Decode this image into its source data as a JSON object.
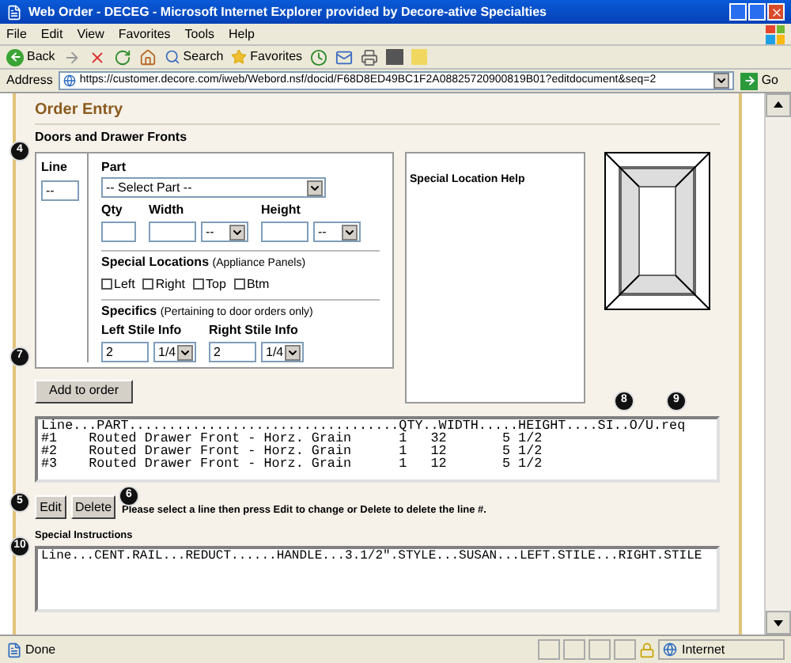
{
  "window": {
    "title": "Web Order - DECEG - Microsoft Internet Explorer provided by Decore-ative Specialties"
  },
  "menu": [
    "File",
    "Edit",
    "View",
    "Favorites",
    "Tools",
    "Help"
  ],
  "toolbar": {
    "back": "Back",
    "search": "Search",
    "favorites": "Favorites"
  },
  "address": {
    "label": "Address",
    "url": "https://customer.decore.com/iweb/Webord.nsf/docid/F68D8ED49BC1F2A08825720900819B01?editdocument&seq=2",
    "go": "Go"
  },
  "page": {
    "heading": "Order Entry",
    "section": "Doors and Drawer Fronts"
  },
  "form": {
    "line": {
      "label": "Line",
      "value": "--"
    },
    "part": {
      "label": "Part",
      "value": "-- Select Part --"
    },
    "qty": {
      "label": "Qty"
    },
    "width": {
      "label": "Width",
      "unit": "--"
    },
    "height": {
      "label": "Height",
      "unit": "--"
    },
    "special_locations": {
      "label": "Special Locations",
      "note": "(Appliance Panels)",
      "options": [
        {
          "label": "Left",
          "checked": false
        },
        {
          "label": "Right",
          "checked": false
        },
        {
          "label": "Top",
          "checked": false
        },
        {
          "label": "Btm",
          "checked": false
        }
      ]
    },
    "specifics": {
      "label": "Specifics",
      "note": "(Pertaining to door orders only)"
    },
    "left_stile": {
      "label": "Left Stile Info",
      "value": "2",
      "fraction": "1/4"
    },
    "right_stile": {
      "label": "Right Stile Info",
      "value": "2",
      "fraction": "1/4"
    }
  },
  "help_panel": {
    "title": "Special Location Help"
  },
  "add_button": "Add to order",
  "order_list": {
    "header": "Line...PART..................................QTY..WIDTH.....HEIGHT....SI..O/U.req",
    "rows": [
      {
        "text": "#1    Routed Drawer Front - Horz. Grain      1   32       5 1/2",
        "selected": false
      },
      {
        "text": "#2    Routed Drawer Front - Horz. Grain      1   12       5 1/2",
        "selected": false
      },
      {
        "text": "#3    Routed Drawer Front - Horz. Grain      1   12       5 1/2",
        "selected": false
      }
    ]
  },
  "edit_button": "Edit",
  "delete_button": "Delete",
  "list_hint": "Please select a line then press Edit to change or Delete to delete the line #.",
  "special_instructions": {
    "label": "Special Instructions",
    "value": "Line...CENT.RAIL...REDUCT......HANDLE...3.1/2\".STYLE...SUSAN...LEFT.STILE...RIGHT.STILE"
  },
  "callouts": [
    "4",
    "7",
    "8",
    "9",
    "5",
    "6",
    "10"
  ],
  "status_bar": {
    "text": "Done",
    "zone": "Internet"
  }
}
